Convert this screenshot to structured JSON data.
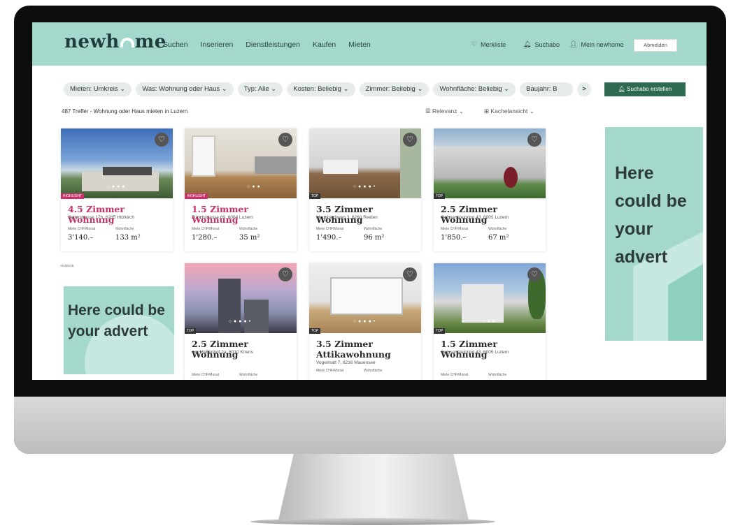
{
  "brand": {
    "logo_pre": "newh",
    "logo_post": "me",
    "accent": "#a5d8cd",
    "highlight": "#c8306a",
    "button": "#2d6a50"
  },
  "nav": [
    "Suchen",
    "Inserieren",
    "Dienstleistungen",
    "Kaufen",
    "Mieten"
  ],
  "user_nav": {
    "merkliste": "Merkliste",
    "suchabo": "Suchabo",
    "profile": "Mein newhome",
    "logout": "Abmelden"
  },
  "filters": [
    "Mieten: Umkreis",
    "Was: Wohnung oder Haus",
    "Typ: Alle",
    "Kosten: Beliebig",
    "Zimmer: Beliebig",
    "Wohnfläche: Beliebig",
    "Baujahr: B"
  ],
  "scroll_more": ">",
  "create_alert": "Suchabo erstellen",
  "results_text": "487 Treffer - Wohnung oder Haus mieten in Luzern",
  "sort": "Relevanz",
  "view": "Kachelansicht",
  "labels": {
    "price": "Miete CHF/Monat",
    "area": "Wohnfläche"
  },
  "listings": [
    {
      "tag": "HIGHLIGHT",
      "title": "4.5 Zimmer Wohnung",
      "address": "Seilerstrasse 17b, 6285 Hitzkirch",
      "price": "3'140.–",
      "area": "133 m²"
    },
    {
      "tag": "HIGHLIGHT",
      "title": "1.5 Zimmer Wohnung",
      "address": "Zürichstrasse 69, 6004 Luzern",
      "price": "1'280.–",
      "area": "35 m²"
    },
    {
      "tag": "TOP",
      "title": "3.5 Zimmer Wohnung",
      "address": "Moosbachweg 3, 6260 Reiden",
      "price": "1'490.–",
      "area": "96 m²"
    },
    {
      "tag": "TOP",
      "title": "2.5 Zimmer Wohnung",
      "address": "Geissensteinring 43, 6005 Luzern",
      "price": "1'850.–",
      "area": "67 m²"
    },
    {
      "tag": "TOP",
      "title": "2.5 Zimmer Wohnung",
      "address": "Am Mattenhof 2a, 6010 Kriens"
    },
    {
      "tag": "TOP",
      "title": "3.5 Zimmer Attikawohnung",
      "address": "Vogelmatt 7, 6216 Mauensee"
    },
    {
      "tag": "TOP",
      "title": "1.5 Zimmer Wohnung",
      "address": "Geissensteinring 43, 6005 Luzern"
    }
  ],
  "ad_label": "ANZEIGE",
  "ad_side": "Here could be your advert",
  "ad_inline": "Here could be your advert"
}
